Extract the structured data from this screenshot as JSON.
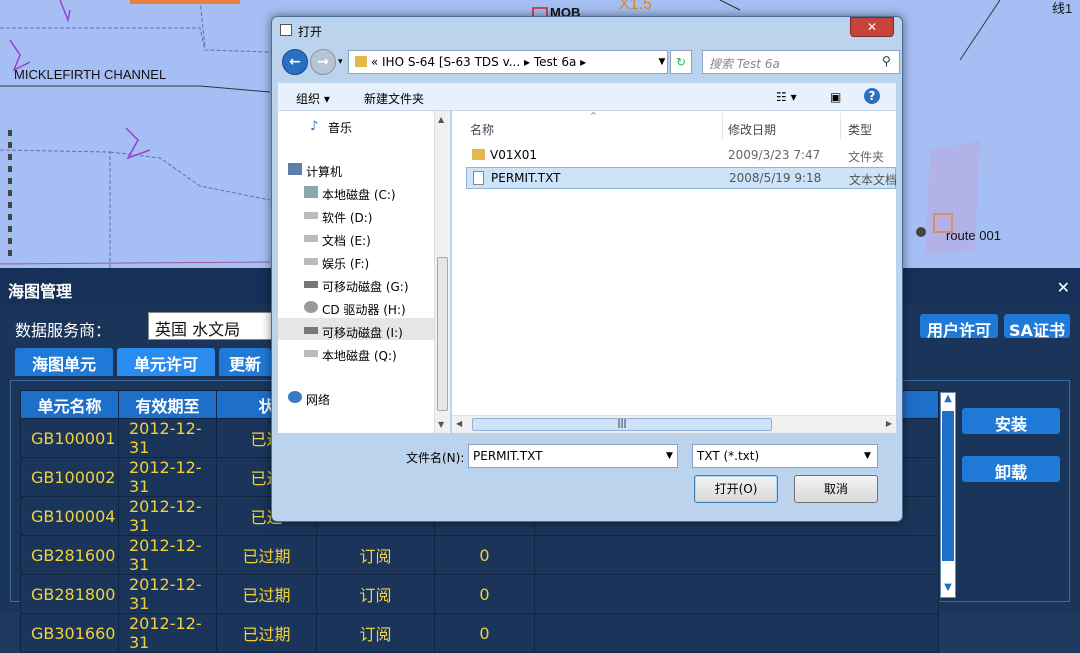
{
  "chart_view": {
    "labels": {
      "channel": "MICKLEFIRTH CHANNEL",
      "mob": "MOB",
      "route": "route 001",
      "line1": "线1",
      "fragment_x": "X1.5"
    }
  },
  "dialog": {
    "title": "打开",
    "close_label": "✕",
    "address": {
      "prefix": "«",
      "crumbs": [
        "IHO S-64 [S-63 TDS v...",
        "Test 6a"
      ]
    },
    "search_placeholder": "搜索 Test 6a",
    "toolbar": {
      "organize": "组织 ▾",
      "new_folder": "新建文件夹"
    },
    "nav_items": [
      {
        "label": "音乐",
        "icon": "music-icon"
      },
      {
        "label": "计算机",
        "icon": "computer-icon"
      },
      {
        "label": "本地磁盘 (C:)",
        "icon": "drive-icon"
      },
      {
        "label": "软件 (D:)",
        "icon": "drive-icon"
      },
      {
        "label": "文档 (E:)",
        "icon": "drive-icon"
      },
      {
        "label": "娱乐 (F:)",
        "icon": "drive-icon"
      },
      {
        "label": "可移动磁盘 (G:)",
        "icon": "removable-drive-icon"
      },
      {
        "label": "CD 驱动器 (H:)",
        "icon": "cd-drive-icon"
      },
      {
        "label": "可移动磁盘 (I:)",
        "icon": "removable-drive-icon"
      },
      {
        "label": "本地磁盘 (Q:)",
        "icon": "drive-icon"
      },
      {
        "label": "网络",
        "icon": "network-icon"
      }
    ],
    "columns": [
      "名称",
      "修改日期",
      "类型"
    ],
    "files": [
      {
        "name": "V01X01",
        "date": "2009/3/23 7:47",
        "type": "文件夹",
        "icon": "folder-icon"
      },
      {
        "name": "PERMIT.TXT",
        "date": "2008/5/19 9:18",
        "type": "文本文档",
        "icon": "text-file-icon"
      }
    ],
    "filename_label": "文件名(N):",
    "filename_value": "PERMIT.TXT",
    "filetype_value": "TXT (*.txt)",
    "open_label": "打开(O)",
    "cancel_label": "取消"
  },
  "panel": {
    "title": "海图管理",
    "close_label": "✕",
    "provider_label": "数据服务商：",
    "provider_value": "英国 水文局",
    "tabs": [
      "海图单元",
      "单元许可",
      "更新"
    ],
    "right_buttons": {
      "user_license": "用户许可",
      "sa_cert": "SA证书"
    },
    "side_buttons": {
      "install": "安装",
      "uninstall": "卸载"
    },
    "table": {
      "headers": [
        "单元名称",
        "有效期至",
        "状"
      ],
      "rows": [
        {
          "name": "GB100001",
          "expiry": "2012-12-31",
          "status": "已过",
          "sub": "",
          "count": ""
        },
        {
          "name": "GB100002",
          "expiry": "2012-12-31",
          "status": "已过",
          "sub": "",
          "count": ""
        },
        {
          "name": "GB100004",
          "expiry": "2012-12-31",
          "status": "已过",
          "sub": "",
          "count": ""
        },
        {
          "name": "GB281600",
          "expiry": "2012-12-31",
          "status": "已过期",
          "sub": "订阅",
          "count": "0"
        },
        {
          "name": "GB281800",
          "expiry": "2012-12-31",
          "status": "已过期",
          "sub": "订阅",
          "count": "0"
        },
        {
          "name": "GB301660",
          "expiry": "2012-12-31",
          "status": "已过期",
          "sub": "订阅",
          "count": "0"
        }
      ]
    }
  },
  "colors": {
    "chart_sea": "#a5bff4",
    "panel_bg": "#1b355a",
    "accent_blue": "#1e7ad6",
    "table_text": "#f0d23a"
  }
}
